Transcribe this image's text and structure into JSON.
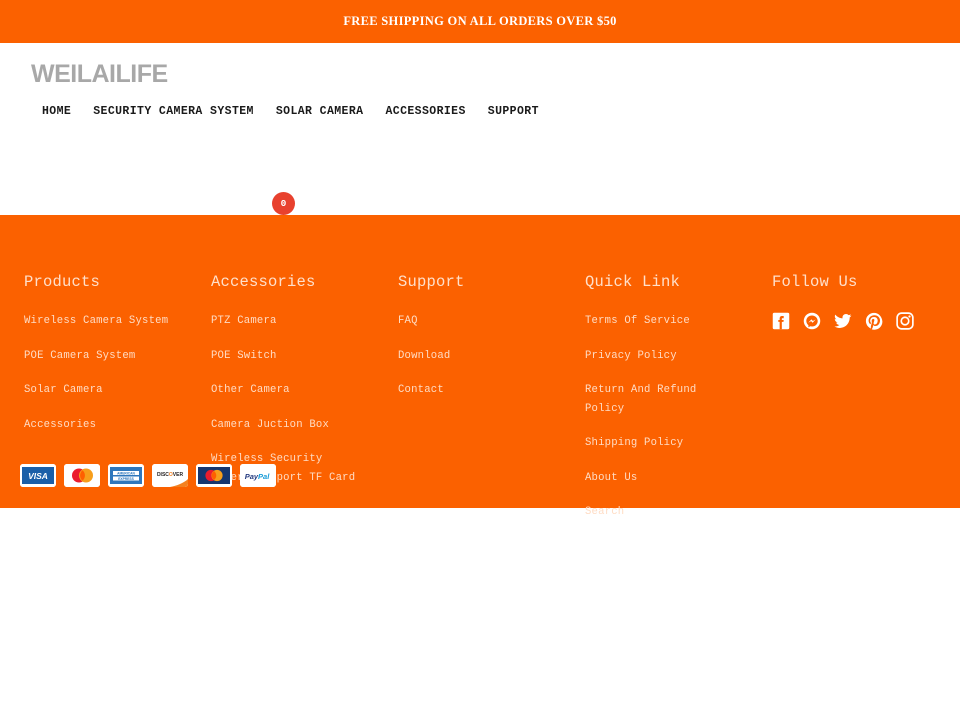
{
  "colors": {
    "brand_orange": "#FB6100",
    "announcement_text": "#FFFFFF",
    "logo_gray": "#A8A8A8",
    "footer_heading": "#FFE0CB",
    "footer_link": "#FFDCC4",
    "cart_badge": "#E8412E"
  },
  "announcement": {
    "text": "FREE SHIPPING ON ALL ORDERS OVER $50"
  },
  "header": {
    "logo_text": "WEILAILIFE",
    "nav": [
      {
        "label": "HOME",
        "name": "nav-item-home"
      },
      {
        "label": "SECURITY CAMERA SYSTEM",
        "name": "nav-item-security-camera-system"
      },
      {
        "label": "SOLAR CAMERA",
        "name": "nav-item-solar-camera"
      },
      {
        "label": "ACCESSORIES",
        "name": "nav-item-accessories"
      },
      {
        "label": "SUPPORT",
        "name": "nav-item-support"
      }
    ],
    "cart": {
      "count": "0"
    }
  },
  "footer": {
    "columns": [
      {
        "heading": "Products",
        "links": [
          "Wireless Camera System",
          "POE Camera System",
          "Solar Camera",
          "Accessories"
        ]
      },
      {
        "heading": "Accessories",
        "links": [
          "PTZ Camera",
          "POE Switch",
          "Other Camera",
          "Camera Juction Box",
          "Wireless Security Camera Support TF Card"
        ]
      },
      {
        "heading": "Support",
        "links": [
          "FAQ",
          "Download",
          "Contact"
        ]
      },
      {
        "heading": "Quick Link",
        "links": [
          "Terms Of Service",
          "Privacy Policy",
          "Return And Refund Policy",
          "Shipping Policy",
          "About Us",
          "Search"
        ]
      }
    ],
    "follow": {
      "heading": "Follow Us",
      "socials": [
        "facebook-icon",
        "messenger-icon",
        "twitter-icon",
        "pinterest-icon",
        "instagram-icon"
      ]
    },
    "payments": [
      "visa-icon",
      "mastercard-icon",
      "american-express-icon",
      "discover-icon",
      "maestro-icon",
      "paypal-icon"
    ]
  }
}
